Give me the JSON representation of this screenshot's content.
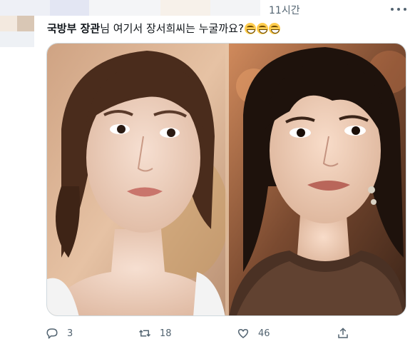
{
  "tweet": {
    "timestamp": "11시간",
    "mention": "국방부 장관",
    "text": "님 여기서 장서희씨는 누굴까요?",
    "emoji_count": 3
  },
  "actions": {
    "reply_count": "3",
    "retweet_count": "18",
    "like_count": "46"
  },
  "icons": {
    "reply": "comment-bubble-icon",
    "retweet": "retweet-arrows-icon",
    "like": "heart-icon",
    "share": "share-upload-icon",
    "more": "more-dots-icon"
  },
  "colors": {
    "text": "#0f1419",
    "secondary": "#536471",
    "border": "#cfd9de"
  }
}
